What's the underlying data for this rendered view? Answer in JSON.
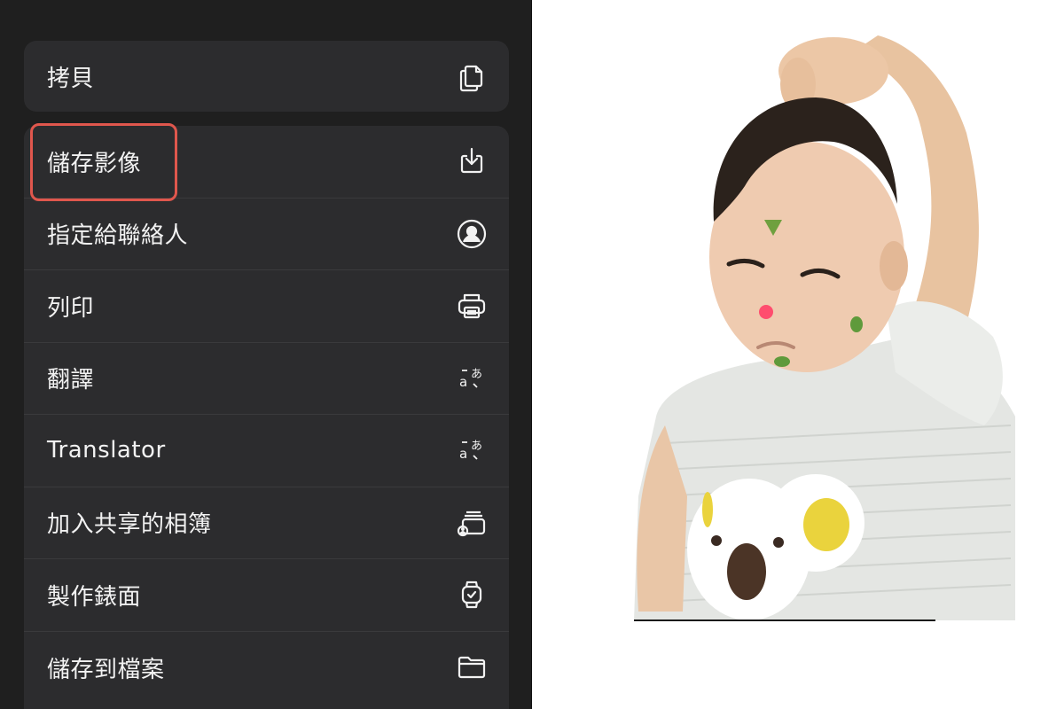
{
  "share_sheet": {
    "copy": {
      "label": "拷貝",
      "icon": "copy-icon"
    },
    "actions": [
      {
        "label": "儲存影像",
        "icon": "save-image-icon"
      },
      {
        "label": "指定給聯絡人",
        "icon": "contact-icon"
      },
      {
        "label": "列印",
        "icon": "printer-icon"
      },
      {
        "label": "翻譯",
        "icon": "translate-icon"
      },
      {
        "label": "Translator",
        "icon": "translate-icon"
      },
      {
        "label": "加入共享的相簿",
        "icon": "shared-album-icon"
      },
      {
        "label": "製作錶面",
        "icon": "watch-face-icon"
      },
      {
        "label": "儲存到檔案",
        "icon": "folder-icon"
      }
    ],
    "highlighted_item": "儲存影像"
  },
  "colors": {
    "panel_bg": "#1f1f1f",
    "group_bg": "#2c2c2e",
    "text": "#f2f2f2",
    "highlight": "#e0574d"
  }
}
